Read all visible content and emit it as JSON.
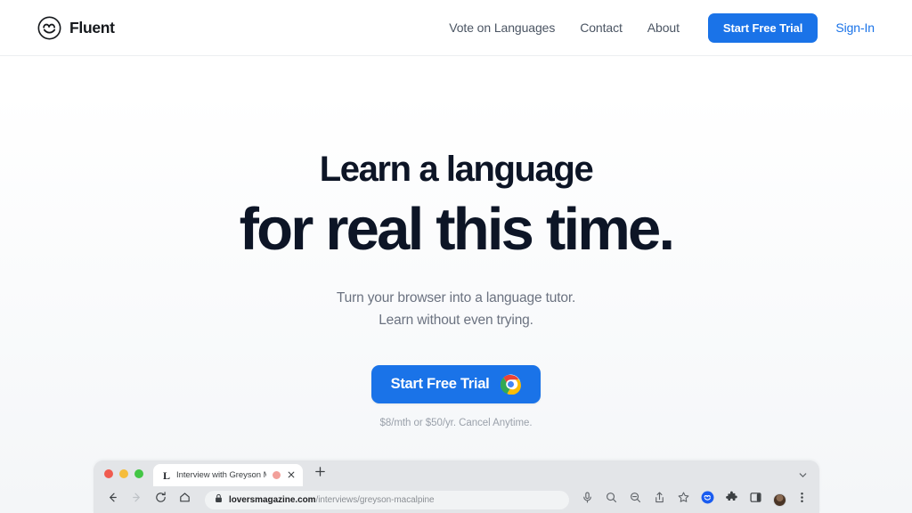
{
  "brand": {
    "name": "Fluent",
    "logo_icon": "fluent-circle-face-icon"
  },
  "nav": {
    "links": [
      {
        "label": "Vote on Languages",
        "name": "nav-vote-on-languages"
      },
      {
        "label": "Contact",
        "name": "nav-contact"
      },
      {
        "label": "About",
        "name": "nav-about"
      }
    ],
    "cta_label": "Start Free Trial",
    "signin_label": "Sign-In",
    "accent_color": "#1a73e8"
  },
  "hero": {
    "headline_line1": "Learn a language",
    "headline_line2": "for real this time.",
    "subtitle_line1": "Turn your browser into a language tutor.",
    "subtitle_line2": "Learn without even trying.",
    "cta_label": "Start Free Trial",
    "cta_icon": "chrome-icon",
    "price_note": "$8/mth or $50/yr. Cancel Anytime.",
    "headline_color": "#0d1526",
    "subtitle_color": "#6b7280"
  },
  "browser_mockup": {
    "window_controls": [
      "close",
      "minimize",
      "maximize"
    ],
    "tab": {
      "favicon_letter": "L",
      "title": "Interview with Greyson Ma",
      "recording_indicator": "recording-dot-icon",
      "close_icon": "close-icon"
    },
    "new_tab_icon": "plus-icon",
    "tab_list_icon": "chevron-down-icon",
    "toolbar": {
      "back_icon": "arrow-left-icon",
      "forward_icon": "arrow-right-icon",
      "reload_icon": "reload-icon",
      "home_icon": "home-icon",
      "lock_icon": "lock-icon",
      "url_domain": "loversmagazine.com",
      "url_path": "/interviews/greyson-macalpine",
      "right_icons": [
        "microphone-icon",
        "search-icon",
        "zoom-out-icon",
        "share-icon",
        "bookmark-star-icon",
        "fluent-extension-icon",
        "extensions-puzzle-icon",
        "side-panel-icon",
        "avatar",
        "more-menu-icon"
      ]
    }
  }
}
